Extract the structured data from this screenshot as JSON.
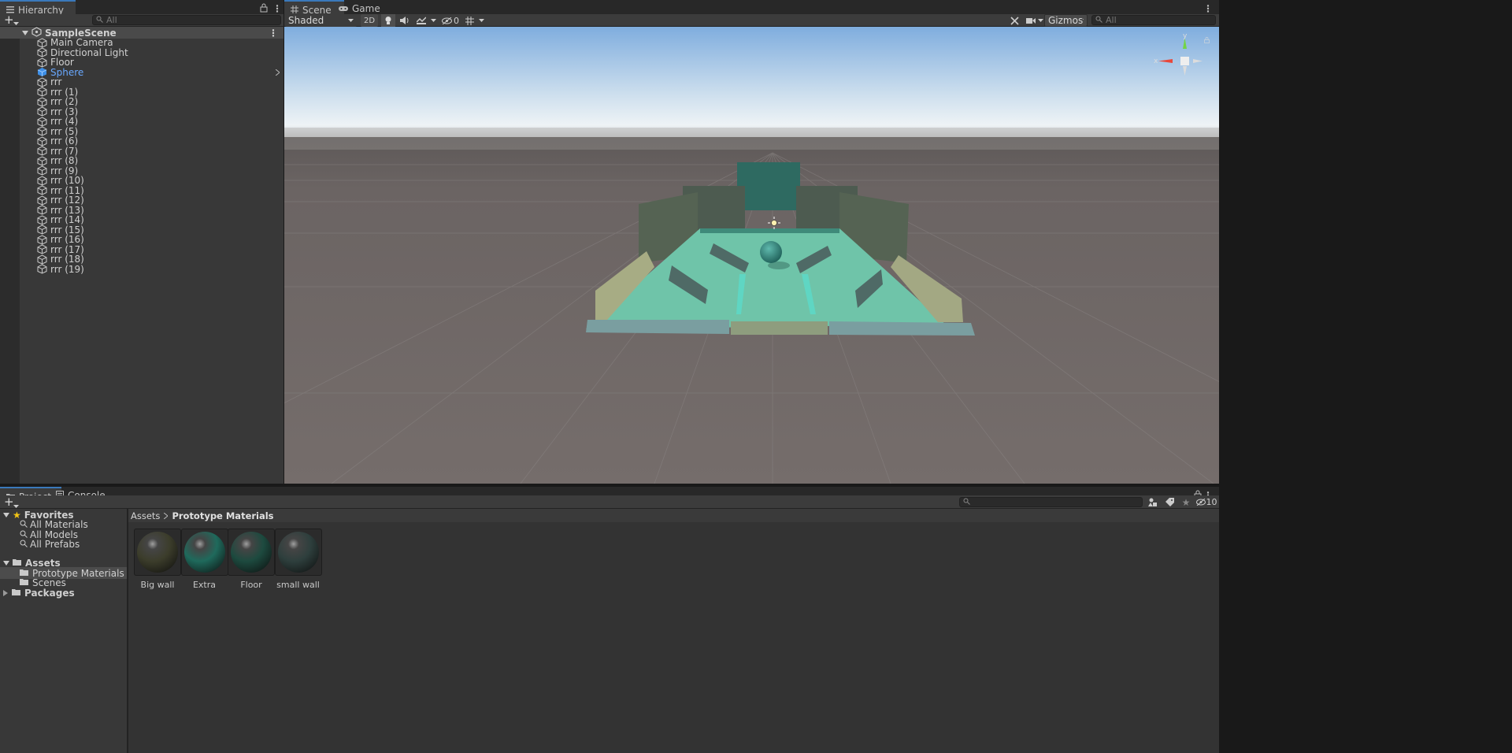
{
  "hierarchy": {
    "tab_label": "Hierarchy",
    "search_placeholder": "All",
    "scene_name": "SampleScene",
    "items": [
      {
        "label": "Main Camera"
      },
      {
        "label": "Directional Light"
      },
      {
        "label": "Floor"
      },
      {
        "label": "Sphere",
        "selected": true
      },
      {
        "label": "rrr"
      },
      {
        "label": "rrr (1)"
      },
      {
        "label": "rrr (2)"
      },
      {
        "label": "rrr (3)"
      },
      {
        "label": "rrr (4)"
      },
      {
        "label": "rrr (5)"
      },
      {
        "label": "rrr (6)"
      },
      {
        "label": "rrr (7)"
      },
      {
        "label": "rrr (8)"
      },
      {
        "label": "rrr (9)"
      },
      {
        "label": "rrr (10)"
      },
      {
        "label": "rrr (11)"
      },
      {
        "label": "rrr (12)"
      },
      {
        "label": "rrr (13)"
      },
      {
        "label": "rrr (14)"
      },
      {
        "label": "rrr (15)"
      },
      {
        "label": "rrr (16)"
      },
      {
        "label": "rrr (17)"
      },
      {
        "label": "rrr (18)"
      },
      {
        "label": "rrr (19)"
      }
    ]
  },
  "scene_view": {
    "tabs": [
      {
        "label": "Scene"
      },
      {
        "label": "Game"
      }
    ],
    "shading_mode": "Shaded",
    "mode_2d": "2D",
    "hidden_count": "0",
    "gizmos_label": "Gizmos",
    "search_placeholder": "All",
    "gizmo_axes": {
      "y": "y",
      "x": "x"
    },
    "icons": [
      "grid-icon",
      "gamepad-icon",
      "light-icon",
      "audio-icon",
      "effects-icon",
      "visibility-icon",
      "grid-snap-icon",
      "tools-icon",
      "camera-icon"
    ]
  },
  "project": {
    "tabs": [
      {
        "label": "Project"
      },
      {
        "label": "Console"
      }
    ],
    "hidden_count": "10",
    "tree": {
      "favorites_label": "Favorites",
      "favorites": [
        {
          "label": "All Materials"
        },
        {
          "label": "All Models"
        },
        {
          "label": "All Prefabs"
        }
      ],
      "assets_label": "Assets",
      "assets_children": [
        {
          "label": "Prototype Materials"
        },
        {
          "label": "Scenes"
        }
      ],
      "packages_label": "Packages"
    },
    "breadcrumb": {
      "root": "Assets",
      "current": "Prototype Materials"
    },
    "assets": [
      {
        "label": "Big wall",
        "color": "#3c3d2b"
      },
      {
        "label": "Extra",
        "color": "#1f6a5c"
      },
      {
        "label": "Floor",
        "color": "#1d4a3f"
      },
      {
        "label": "small wall",
        "color": "#2e3f3d"
      }
    ]
  },
  "colors": {
    "accent": "#3a79bb",
    "selection": "#69a8ff",
    "sky_top": "#80aee0",
    "ground": "#6e6766",
    "board": "#6ac8ab"
  }
}
